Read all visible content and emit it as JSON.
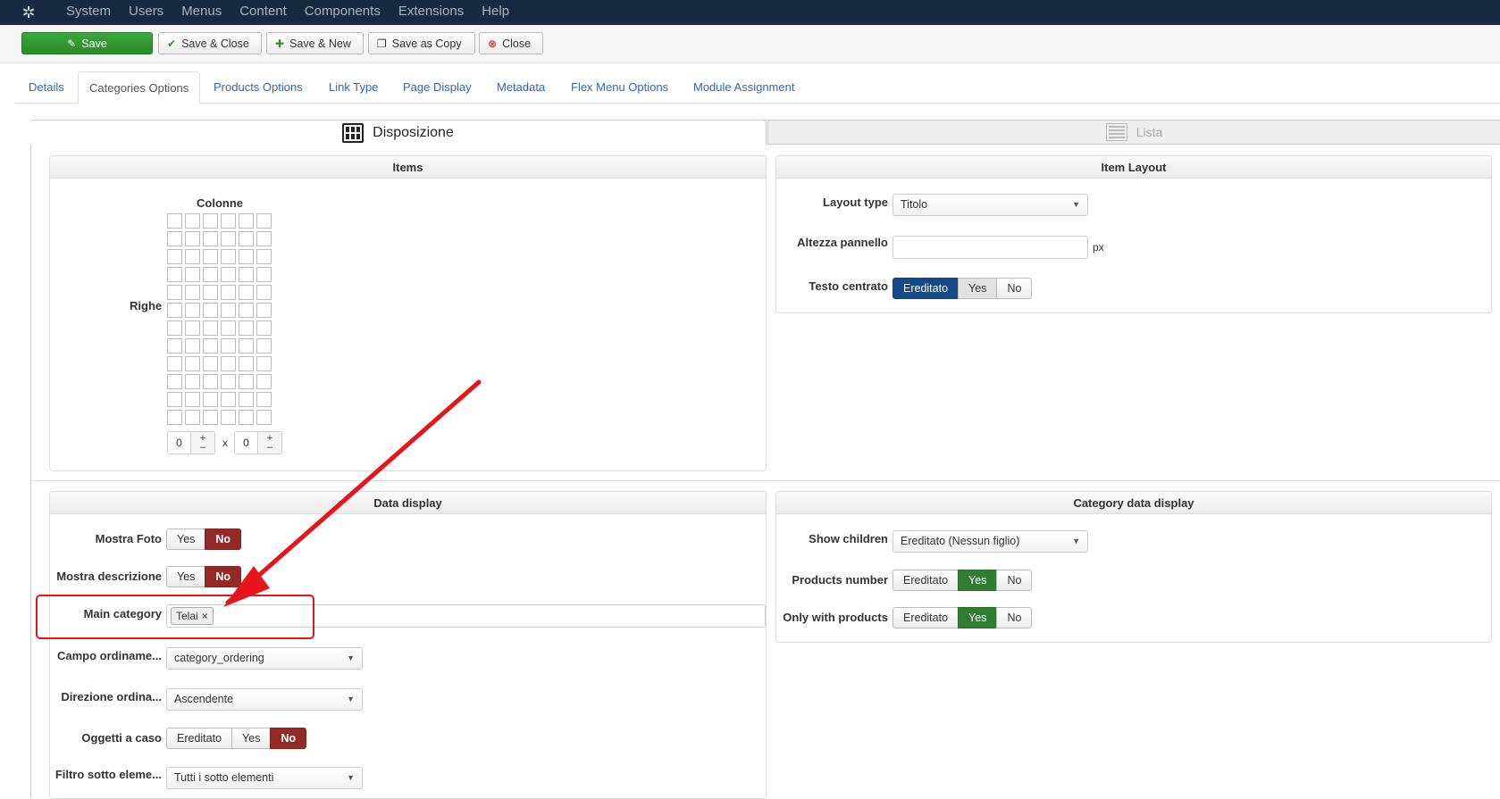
{
  "navbar": {
    "items": [
      "System",
      "Users",
      "Menus",
      "Content",
      "Components",
      "Extensions",
      "Help"
    ]
  },
  "toolbar": {
    "save": "Save",
    "save_close": "Save & Close",
    "save_new": "Save & New",
    "save_copy": "Save as Copy",
    "close": "Close"
  },
  "tabs": [
    "Details",
    "Categories Options",
    "Products Options",
    "Link Type",
    "Page Display",
    "Metadata",
    "Flex Menu Options",
    "Module Assignment"
  ],
  "subtabs": {
    "left": "Disposizione",
    "right": "Lista"
  },
  "items_panel": {
    "title": "Items",
    "columns_label": "Colonne",
    "rows_label": "Righe",
    "cols_value": "0",
    "rows_value": "0",
    "times": "x",
    "plus": "+",
    "minus": "–"
  },
  "item_layout": {
    "title": "Item Layout",
    "layout_type_label": "Layout type",
    "layout_type_value": "Titolo",
    "altezza_label": "Altezza pannello",
    "altezza_unit": "px",
    "testo_label": "Testo centrato",
    "testo_options": [
      "Ereditato",
      "Yes",
      "No"
    ]
  },
  "data_display": {
    "title": "Data display",
    "mostra_foto_label": "Mostra Foto",
    "mostra_descr_label": "Mostra descrizione",
    "yes": "Yes",
    "no": "No",
    "main_cat_label": "Main category",
    "main_cat_tag": "Telai",
    "tag_remove": "×",
    "campo_label": "Campo ordiname...",
    "campo_value": "category_ordering",
    "direzione_label": "Direzione ordina...",
    "direzione_value": "Ascendente",
    "oggetti_label": "Oggetti a caso",
    "oggetti_options": [
      "Ereditato",
      "Yes",
      "No"
    ],
    "filtro_label": "Filtro sotto eleme...",
    "filtro_value": "Tutti i sotto elementi"
  },
  "category_display": {
    "title": "Category data display",
    "show_children_label": "Show children",
    "show_children_value": "Ereditato (Nessun figlio)",
    "products_number_label": "Products number",
    "only_products_label": "Only with products",
    "options": [
      "Ereditato",
      "Yes",
      "No"
    ]
  },
  "colors": {
    "navbar": "#172a42",
    "save_green": "#2f8f2f",
    "active_blue": "#154a8a",
    "active_red": "#942a25",
    "active_green": "#2f7d32",
    "annotation_red": "#e8141b"
  }
}
